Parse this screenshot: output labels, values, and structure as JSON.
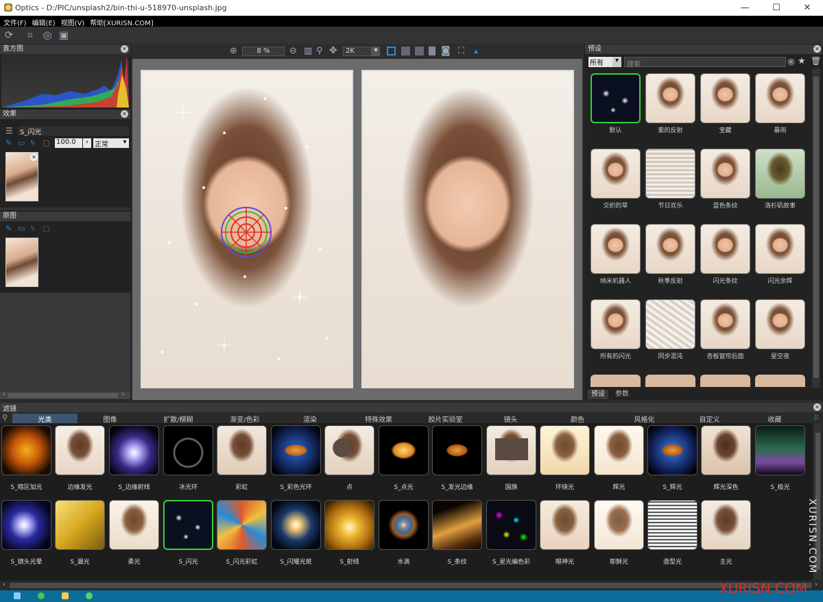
{
  "window": {
    "title": "Optics - D:/PIC/unsplash2/bin-thi-u-518970-unsplash.jpg",
    "min": "—",
    "max": "☐",
    "close": "✕"
  },
  "menu": [
    "文件(F)",
    "编辑(E)",
    "视图(V)",
    "帮助[XURISN.COM]"
  ],
  "histogram": {
    "title": "直方图"
  },
  "effects": {
    "title": "效果",
    "layer_name": "S_闪光",
    "opacity": "100.0",
    "blend_mode": "正常"
  },
  "original": {
    "title": "原图"
  },
  "viewbar": {
    "zoom": "8 %",
    "size": "2K"
  },
  "presets": {
    "title": "预设",
    "filter_select": "所有",
    "search_placeholder": "搜索",
    "items": [
      "默认",
      "紫的反射",
      "宝藏",
      "暴雨",
      "交织的草",
      "节日欢乐",
      "蓝色条纹",
      "洛杉矶故事",
      "纳米机器人",
      "秋季反射",
      "闪光条纹",
      "闪光余辉",
      "所有的闪光",
      "同步混沌",
      "杏板窗帘后面",
      "星空夜"
    ],
    "tabs": [
      "预设",
      "参数"
    ]
  },
  "filters": {
    "title": "滤镜",
    "categories": [
      "光类",
      "图像",
      "扩散/模糊",
      "渐变/色彩",
      "渲染",
      "特殊效果",
      "胶片实验室",
      "镜头",
      "颜色",
      "风格化",
      "自定义",
      "收藏"
    ],
    "row1": [
      "S_暗区加光",
      "边缘发光",
      "S_边缘射线",
      "冰光环",
      "彩虹",
      "S_彩色光环",
      "点",
      "S_点光",
      "S_发光边缘",
      "国旗",
      "环绕光",
      "辉光",
      "S_辉光",
      "辉光深色",
      "S_极光"
    ],
    "row2": [
      "S_镜头光晕",
      "S_漏光",
      "柔光",
      "S_闪光",
      "S_闪光彩虹",
      "S_闪耀光斑",
      "S_射线",
      "水滴",
      "S_条纹",
      "S_星光编色彩",
      "眼神光",
      "耶稣光",
      "造型光",
      "主光"
    ]
  },
  "watermark": {
    "side": "XURISN.COM",
    "corner": "XURISN.COM"
  },
  "colors": {
    "accent": "#2a8ad8",
    "selected_border": "#3bd13b",
    "histogram_red": "#e0302a",
    "histogram_green": "#35c03a",
    "histogram_blue": "#2a5ae0"
  }
}
